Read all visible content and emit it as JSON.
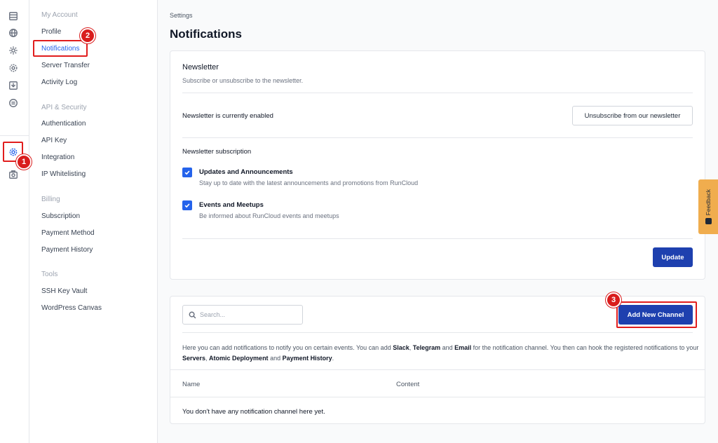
{
  "rail": {
    "icons": [
      "servers-icon",
      "globe-icon",
      "cog-icon",
      "cloud-settings-icon",
      "download-icon",
      "network-icon",
      "settings-gear-icon",
      "camera-icon"
    ]
  },
  "menu": {
    "groups": {
      "account": "My Account",
      "api": "API & Security",
      "billing": "Billing",
      "tools": "Tools"
    },
    "items": {
      "profile": "Profile",
      "notifications": "Notifications",
      "server_transfer": "Server Transfer",
      "activity_log": "Activity Log",
      "authentication": "Authentication",
      "api_key": "API Key",
      "integration": "Integration",
      "ip_whitelisting": "IP Whitelisting",
      "subscription": "Subscription",
      "payment_method": "Payment Method",
      "payment_history": "Payment History",
      "ssh_key_vault": "SSH Key Vault",
      "wordpress_canvas": "WordPress Canvas"
    }
  },
  "breadcrumb": "Settings",
  "page_title": "Notifications",
  "newsletter": {
    "title": "Newsletter",
    "subtitle": "Subscribe or unsubscribe to the newsletter.",
    "status": "Newsletter is currently enabled",
    "unsubscribe_label": "Unsubscribe from our newsletter",
    "subscription_label": "Newsletter subscription",
    "options": [
      {
        "title": "Updates and Announcements",
        "desc": "Stay up to date with the latest announcements and promotions from RunCloud",
        "checked": true
      },
      {
        "title": "Events and Meetups",
        "desc": "Be informed about RunCloud events and meetups",
        "checked": true
      }
    ],
    "update_label": "Update"
  },
  "channels": {
    "search_placeholder": "Search...",
    "add_label": "Add New Channel",
    "info": {
      "p1": "Here you can add notifications to notify you on certain events. You can add ",
      "slack": "Slack",
      "p2": ", ",
      "telegram": "Telegram",
      "p3": " and ",
      "email": "Email",
      "p4": " for the notification channel. You then can hook the registered notifications to your ",
      "servers": "Servers",
      "p5": ", ",
      "atomic": "Atomic Deployment",
      "p6": " and ",
      "payment": "Payment History",
      "p7": "."
    },
    "columns": [
      "Name",
      "Content"
    ],
    "empty": "You don't have any notification channel here yet."
  },
  "feedback_label": "Feedback",
  "annotations": [
    "1",
    "2",
    "3"
  ],
  "colors": {
    "accent": "#2563eb",
    "primary_button": "#1e40af",
    "highlight": "#e11d1d",
    "feedback": "#f0ad4e"
  }
}
